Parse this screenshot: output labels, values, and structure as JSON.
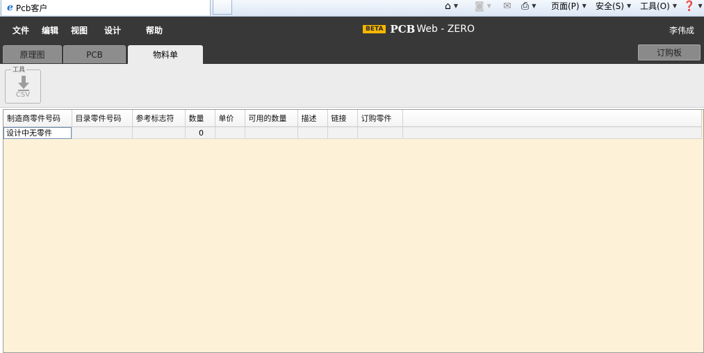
{
  "browser": {
    "tab_title": "Pcb客户",
    "commands": {
      "page": "页面(P)",
      "safety": "安全(S)",
      "tools": "工具(O)"
    }
  },
  "app": {
    "menu": [
      "文件",
      "编辑",
      "视图",
      "设计",
      "帮助"
    ],
    "brand": {
      "beta": "BETA",
      "pcb": "PCB",
      "web": "Web - ZERO"
    },
    "user": "李伟成",
    "tabs": [
      "原理图",
      "PCB",
      "物料单"
    ],
    "active_tab": "物料单",
    "order_board_button": "订购板"
  },
  "toolbar": {
    "export_group_label": "工具",
    "export_csv_label": "CSV"
  },
  "bom_table": {
    "headers": [
      "制造商零件号码",
      "目录零件号码",
      "参考标志符",
      "数量",
      "单价",
      "可用的数量",
      "描述",
      "链接",
      "订购零件"
    ],
    "rows": [
      [
        "设计中无零件",
        "",
        "",
        "0",
        "",
        "",
        "",
        "",
        ""
      ]
    ]
  },
  "colors": {
    "header_bg": "#383838",
    "beta_badge": "#f6b600",
    "grid_bg": "#fdf2d8"
  }
}
